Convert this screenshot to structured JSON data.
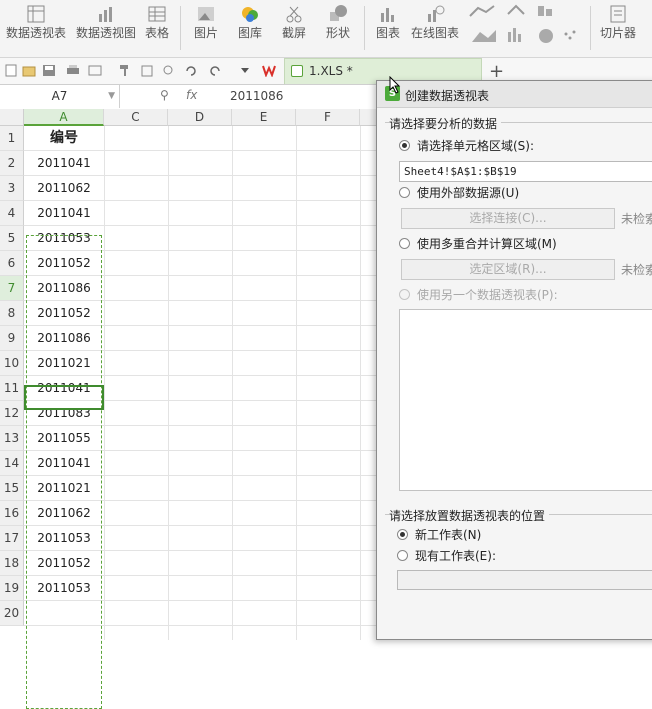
{
  "ribbon": {
    "items": [
      {
        "label": "数据透视表",
        "icon": "pivot-table-icon"
      },
      {
        "label": "数据透视图",
        "icon": "pivot-chart-icon"
      },
      {
        "label": "表格",
        "icon": "table-icon"
      },
      {
        "label": "图片",
        "icon": "picture-icon"
      },
      {
        "label": "图库",
        "icon": "gallery-icon"
      },
      {
        "label": "截屏",
        "icon": "screenshot-icon"
      },
      {
        "label": "形状",
        "icon": "shape-icon"
      },
      {
        "label": "图表",
        "icon": "chart-icon"
      },
      {
        "label": "在线图表",
        "icon": "online-chart-icon"
      },
      {
        "label": "切片器",
        "icon": "slicer-icon"
      }
    ]
  },
  "tab": {
    "label": "1.XLS *",
    "add": "+"
  },
  "formula_bar": {
    "name_box": "A7",
    "fx": "fx",
    "value": "2011086"
  },
  "sheet": {
    "columns": [
      "A",
      "C",
      "D",
      "E",
      "F"
    ],
    "rows": [
      "1",
      "2",
      "3",
      "4",
      "5",
      "6",
      "7",
      "8",
      "9",
      "10",
      "11",
      "12",
      "13",
      "14",
      "15",
      "16",
      "17",
      "18",
      "19",
      "20"
    ],
    "header_cell": "编号",
    "values": [
      "2011041",
      "2011062",
      "2011041",
      "2011053",
      "2011052",
      "2011086",
      "2011052",
      "2011086",
      "2011021",
      "2011041",
      "2011083",
      "2011055",
      "2011041",
      "2011021",
      "2011062",
      "2011053",
      "2011052",
      "2011053"
    ],
    "active_cell": "A7"
  },
  "dialog": {
    "title": "创建数据透视表",
    "section1": "请选择要分析的数据",
    "option_range": "请选择单元格区域(S):",
    "range_value": "Sheet4!$A$1:$B$19",
    "option_external": "使用外部数据源(U)",
    "select_connection": "选择连接(C)...",
    "not_found1": "未检索",
    "option_multi": "使用多重合并计算区域(M)",
    "select_area": "选定区域(R)...",
    "not_found2": "未检索",
    "option_another": "使用另一个数据透视表(P):",
    "section2": "请选择放置数据透视表的位置",
    "option_new_sheet": "新工作表(N)",
    "option_existing": "现有工作表(E):"
  },
  "colors": {
    "accent": "#5aa33a",
    "select_border": "#3f8b2e"
  }
}
